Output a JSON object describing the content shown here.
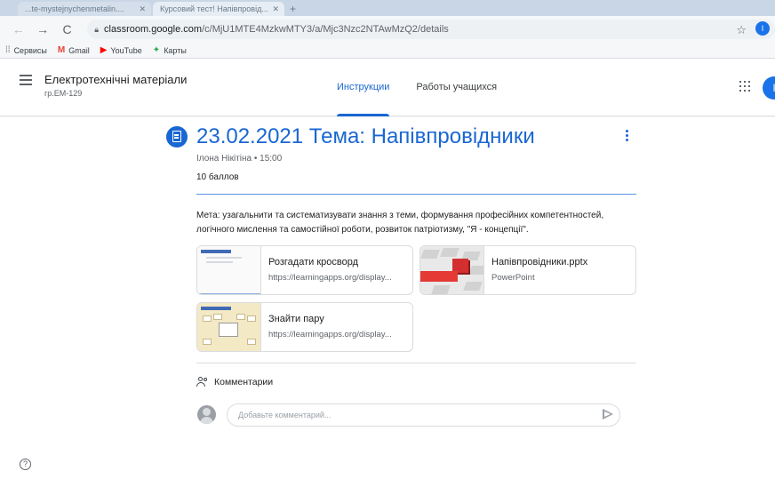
{
  "browser": {
    "tabs": [
      {
        "label": "...te-mystejnychenmetalin...."
      },
      {
        "label": "Курсовий тест! Напівпровід..."
      }
    ],
    "url_domain": "classroom.google.com",
    "url_path": "/c/MjU1MTE4MzkwMTY3/a/Mjc3Nzc2NTAwMzQ2/details",
    "profile_initial": "I",
    "bookmarks": [
      {
        "label": "Сервисы",
        "icon": "apps-icon"
      },
      {
        "label": "Gmail",
        "icon": "gmail-icon"
      },
      {
        "label": "YouTube",
        "icon": "youtube-icon"
      },
      {
        "label": "Карты",
        "icon": "maps-icon"
      }
    ]
  },
  "classroom": {
    "course_title": "Електротехнічні матеріали",
    "course_subtitle": "гр.ЕМ-129",
    "tabs": [
      {
        "label": "Инструкции",
        "active": true
      },
      {
        "label": "Работы учащихся",
        "active": false
      }
    ],
    "user_initial": "I"
  },
  "assignment": {
    "title": "23.02.2021 Тема: Напівпровідники",
    "meta": "Ілона Нікітіна • 15:00",
    "points": "10 баллов",
    "description": "Мета: узагальнити та систематизувати знання з теми, формування професійних компетентностей, логічного мислення та самостійної роботи, розвиток патріотизму, \"Я - концепції\".",
    "attachments": [
      {
        "title": "Розгадати кросворд",
        "subtitle": "https://learningapps.org/display..."
      },
      {
        "title": "Напівпровідники.pptx",
        "subtitle": "PowerPoint"
      },
      {
        "title": "Знайти пару",
        "subtitle": "https://learningapps.org/display..."
      }
    ]
  },
  "comments": {
    "label": "Комментарии",
    "placeholder": "Добавьте комментарий..."
  },
  "colors": {
    "accent": "#1967d2",
    "text": "#202124",
    "muted": "#5f6368"
  }
}
